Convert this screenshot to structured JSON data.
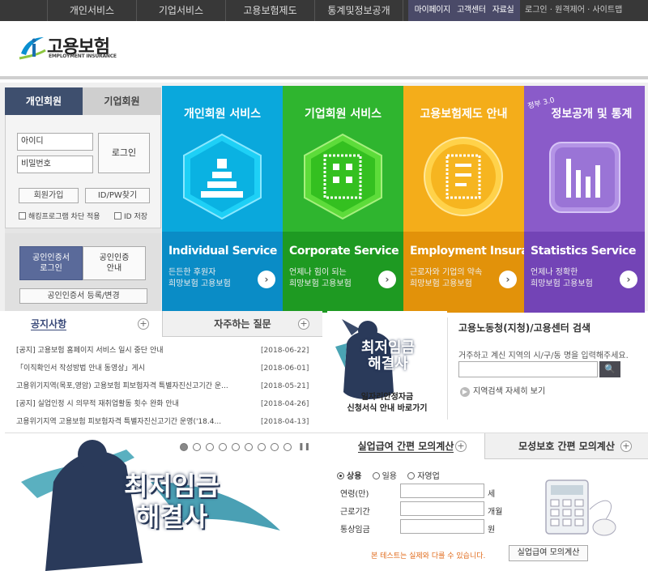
{
  "top_nav": {
    "items": [
      "개인서비스",
      "기업서비스",
      "고용보험제도",
      "통계및정보공개"
    ],
    "mid_links": [
      "마이페이지",
      "고객센터",
      "자료실"
    ],
    "right_links": "로그인 · 원격제어 · 사이트맵"
  },
  "logo": {
    "title": "고용보험",
    "subtitle": "EMPLOYMENT INSURANCE"
  },
  "login": {
    "tab_personal": "개인회원",
    "tab_business": "기업회원",
    "id_placeholder": "아이디",
    "pw_placeholder": "비밀번호",
    "login_button": "로그인",
    "join_button": "회원가입",
    "find_button": "ID/PW찾기",
    "hack_block": "해킹프로그램 차단 적용",
    "save_id": "ID 저장",
    "cert_login_line1": "공인인증서",
    "cert_login_line2": "로그인",
    "cert_guide_line1": "공인인증",
    "cert_guide_line2": "안내",
    "cert_register": "공인인증서 등록/변경"
  },
  "tiles": [
    {
      "title": "개인회원 서비스",
      "en": "Individual Service",
      "sub1": "든든한 후원자",
      "sub2": "희망보험 고용보험",
      "color": "#0aa8dc",
      "bottom": "#0a8cc6"
    },
    {
      "title": "기업회원 서비스",
      "en": "Corporate Service",
      "sub1": "언제나 힘이 되는",
      "sub2": "희망보험 고용보험",
      "color": "#2fb52f",
      "bottom": "#1e9a22"
    },
    {
      "title": "고용보험제도 안내",
      "en": "Employment Insurance",
      "sub1": "근로자와 기업의 약속",
      "sub2": "희망보험 고용보험",
      "color": "#f4ad1a",
      "bottom": "#e2920a"
    },
    {
      "title": "정보공개 및 통계",
      "badge": "정부 3.0",
      "en": "Statistics Service",
      "sub1": "언제나 정확한",
      "sub2": "희망보험 고용보험",
      "color": "#8a5bc9",
      "bottom": "#7344b6"
    }
  ],
  "notice": {
    "tab_notice": "공지사항",
    "tab_faq": "자주하는 질문",
    "plus": "+",
    "items": [
      {
        "title": "[공지] 고용보험 홈페이지 서비스 일시 중단 안내",
        "date": "[2018-06-22]"
      },
      {
        "title": "「이직확인서 작성방법 안내 동영상」게시",
        "date": "[2018-06-01]"
      },
      {
        "title": "고용위기지역(목포,영암) 고용보험 피보험자격 특별자진신고기간 운...",
        "date": "[2018-05-21]"
      },
      {
        "title": "[공지] 실업인정 시 의무적 재취업활동 횟수 완화 안내",
        "date": "[2018-04-26]"
      },
      {
        "title": "고용위기지역 고용보험 피보험자격 특별자진신고기간 운영('18.4...",
        "date": "[2018-04-13]"
      }
    ]
  },
  "banner1": {
    "headline1": "최저임금",
    "headline2": "해결사",
    "caption1": "일자리안정자금",
    "caption2": "신청서식 안내 바로가기"
  },
  "search": {
    "title": "고용노동청(지청)/고용센터 검색",
    "desc": "거주하고 계신 지역의 시/구/동 명을 입력해주세요.",
    "button": "🔍",
    "more": "지역검색 자세히 보기",
    "more_icon": "▶"
  },
  "banner2": {
    "headline1": "최저임금",
    "headline2": "해결사",
    "pause": "❚❚",
    "dot_count": 10,
    "active_dot": 0
  },
  "calc": {
    "tab_unemployment": "실업급여 간편 모의계산",
    "tab_maternity": "모성보호 간편 모의계산",
    "plus": "+",
    "radio_options": [
      "상용",
      "일용",
      "자영업"
    ],
    "fields": [
      {
        "label": "연령(만)",
        "unit": "세"
      },
      {
        "label": "근로기간",
        "unit": "개월"
      },
      {
        "label": "통상임금",
        "unit": "원"
      }
    ],
    "note": "본 테스트는 실제와 다를 수 있습니다.",
    "button": "실업급여 모의계산"
  },
  "colors": {
    "navy": "#3e4f6e",
    "topbar": "#383838"
  }
}
